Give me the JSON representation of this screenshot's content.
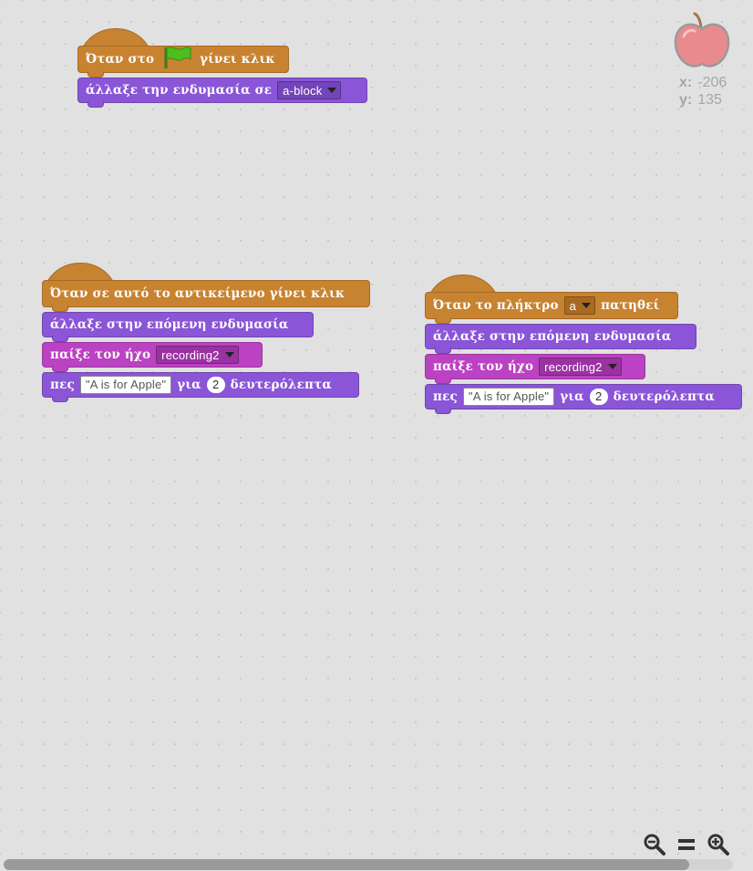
{
  "scripts": [
    {
      "blocks": [
        {
          "type": "hat",
          "category": "events",
          "before": "Όταν στο",
          "icon": "green-flag-icon",
          "after": "γίνει κλικ"
        },
        {
          "type": "stack",
          "category": "looks",
          "label": "άλλαξε την ενδυμασία σε",
          "dropdown": "a-block"
        }
      ]
    },
    {
      "blocks": [
        {
          "type": "hat",
          "category": "events",
          "label": "Όταν σε αυτό το αντικείμενο γίνει κλικ"
        },
        {
          "type": "stack",
          "category": "looks",
          "label": "άλλαξε στην επόμενη ενδυμασία"
        },
        {
          "type": "stack",
          "category": "sound",
          "label": "παίξε τον ήχο",
          "dropdown": "recording2"
        },
        {
          "type": "stack",
          "category": "looks",
          "label": "πες",
          "text": "\"A is for Apple\"",
          "mid": "για",
          "number": "2",
          "after": "δευτερόλεπτα"
        }
      ]
    },
    {
      "blocks": [
        {
          "type": "hat",
          "category": "events",
          "label": "Όταν το πλήκτρο",
          "dropdown": "a",
          "after": "πατηθεί"
        },
        {
          "type": "stack",
          "category": "looks",
          "label": "άλλαξε στην επόμενη ενδυμασία"
        },
        {
          "type": "stack",
          "category": "sound",
          "label": "παίξε τον ήχο",
          "dropdown": "recording2"
        },
        {
          "type": "stack",
          "category": "looks",
          "label": "πες",
          "text": "\"A is for Apple\"",
          "mid": "για",
          "number": "2",
          "after": "δευτερόλεπτα"
        }
      ]
    }
  ],
  "sprite": {
    "icon": "apple-sprite-icon",
    "x_label": "x:",
    "x_value": "-206",
    "y_label": "y:",
    "y_value": "135"
  },
  "zoom_controls": [
    "zoom-out-icon",
    "zoom-reset-icon",
    "zoom-in-icon"
  ],
  "colors": {
    "events": "#c88330",
    "looks": "#8a55d7",
    "sound": "#bb42c3",
    "background": "#e0e1e0"
  }
}
